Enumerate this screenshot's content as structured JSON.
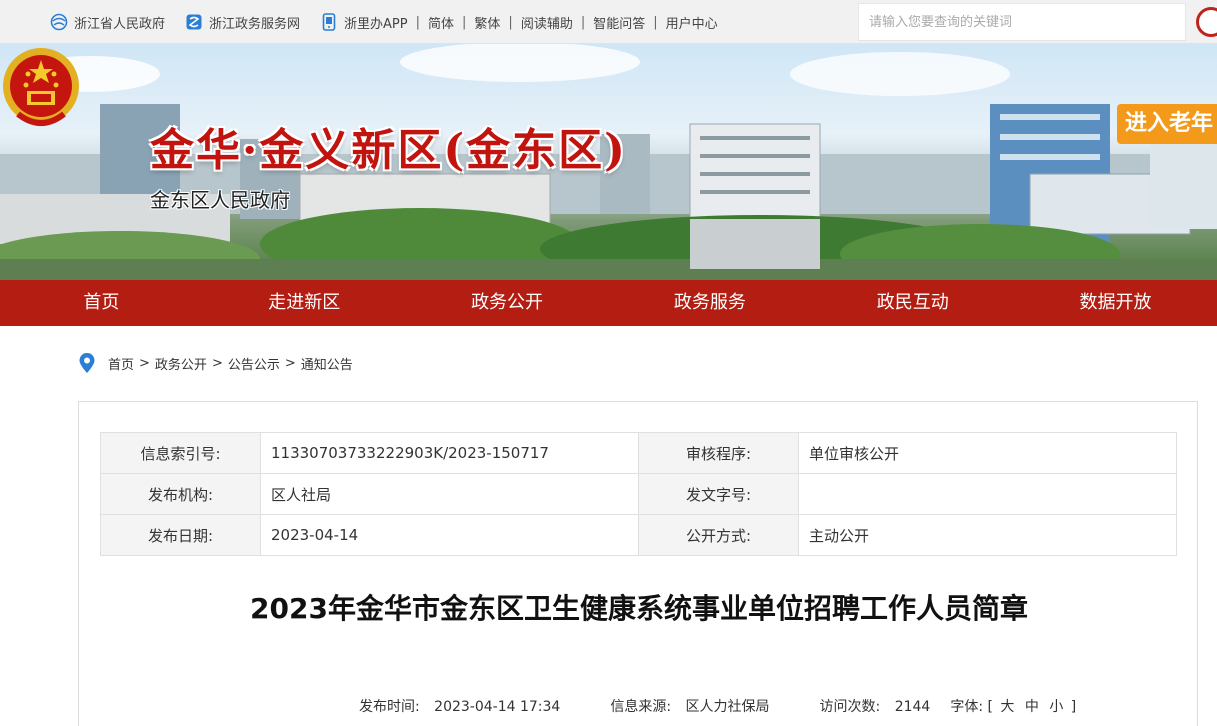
{
  "topbar": {
    "links": [
      {
        "icon": "zhejiang-gov-icon",
        "label": "浙江省人民政府"
      },
      {
        "icon": "service-net-icon",
        "label": "浙江政务服务网"
      },
      {
        "icon": "mobile-app-icon",
        "label": "浙里办APP"
      }
    ],
    "text_links": [
      "简体",
      "繁体",
      "阅读辅助",
      "智能问答",
      "用户中心"
    ],
    "search_placeholder": "请输入您要查询的关键词"
  },
  "banner": {
    "title": "金华·金义新区(金东区)",
    "subtitle": "金东区人民政府",
    "elder_mode": "进入老年"
  },
  "nav": [
    "首页",
    "走进新区",
    "政务公开",
    "政务服务",
    "政民互动",
    "数据开放"
  ],
  "breadcrumb": [
    "首页",
    "政务公开",
    "公告公示",
    "通知公告"
  ],
  "meta": {
    "rows": [
      {
        "k1": "信息索引号:",
        "v1": "11330703733222903K/2023-150717",
        "k2": "审核程序:",
        "v2": "单位审核公开"
      },
      {
        "k1": "发布机构:",
        "v1": "区人社局",
        "k2": "发文字号:",
        "v2": ""
      },
      {
        "k1": "发布日期:",
        "v1": "2023-04-14",
        "k2": "公开方式:",
        "v2": "主动公开"
      }
    ]
  },
  "article": {
    "title": "2023年金华市金东区卫生健康系统事业单位招聘工作人员简章",
    "publish_label": "发布时间:",
    "publish_time": "2023-04-14 17:34",
    "source_label": "信息来源:",
    "source": "区人力社保局",
    "visits_label": "访问次数:",
    "visits": "2144",
    "font_label": "字体:",
    "font_open": "[",
    "font_large": "大",
    "font_medium": "中",
    "font_small": "小",
    "font_close": "]"
  },
  "colors": {
    "brand_red": "#b31d12",
    "title_red": "#c1140f",
    "elder_orange": "#f39a1a"
  }
}
